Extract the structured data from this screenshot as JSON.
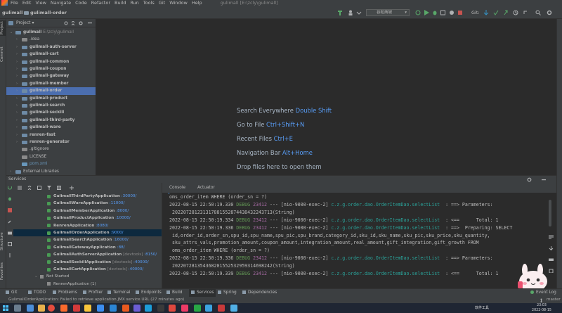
{
  "menubar": {
    "items": [
      "File",
      "Edit",
      "View",
      "Navigate",
      "Code",
      "Refactor",
      "Build",
      "Run",
      "Tools",
      "Git",
      "Window",
      "Help"
    ],
    "project_title": "gulimall [E:\\zcly\\gulimall]"
  },
  "navbar": {
    "breadcrumb": [
      "gulimall",
      "gulimall-order"
    ],
    "run_config": "谷粒商城",
    "git_label": "Git:"
  },
  "project": {
    "header": "Project",
    "tree": [
      {
        "label": "gulimall",
        "path": "E:\\zcly\\gulimall",
        "level": 0,
        "open": true,
        "bold": true
      },
      {
        "label": ".idea",
        "level": 1,
        "open": false,
        "bold": false
      },
      {
        "label": "gulimall-auth-server",
        "level": 1,
        "open": false,
        "bold": true
      },
      {
        "label": "gulimall-cart",
        "level": 1,
        "open": false,
        "bold": true
      },
      {
        "label": "gulimall-common",
        "level": 1,
        "open": false,
        "bold": true
      },
      {
        "label": "gulimall-coupon",
        "level": 1,
        "open": false,
        "bold": true
      },
      {
        "label": "gulimall-gateway",
        "level": 1,
        "open": false,
        "bold": true
      },
      {
        "label": "gulimall-member",
        "level": 1,
        "open": false,
        "bold": true
      },
      {
        "label": "gulimall-order",
        "level": 1,
        "open": false,
        "bold": true,
        "selected": true
      },
      {
        "label": "gulimall-product",
        "level": 1,
        "open": false,
        "bold": true
      },
      {
        "label": "gulimall-search",
        "level": 1,
        "open": false,
        "bold": true
      },
      {
        "label": "gulimall-seckill",
        "level": 1,
        "open": false,
        "bold": true
      },
      {
        "label": "gulimall-third-party",
        "level": 1,
        "open": false,
        "bold": true
      },
      {
        "label": "gulimall-ware",
        "level": 1,
        "open": false,
        "bold": true
      },
      {
        "label": "renren-fast",
        "level": 1,
        "open": false,
        "bold": true
      },
      {
        "label": "renren-generator",
        "level": 1,
        "open": false,
        "bold": true
      },
      {
        "label": ".gitignore",
        "level": 1,
        "leaf": true,
        "bold": false
      },
      {
        "label": "LICENSE",
        "level": 1,
        "leaf": true,
        "bold": false
      },
      {
        "label": "pom.xml",
        "level": 1,
        "leaf": true,
        "bold": false,
        "color": "#6897bb"
      },
      {
        "label": "External Libraries",
        "level": 0,
        "open": false,
        "bold": false
      }
    ]
  },
  "welcome": {
    "items": [
      {
        "label": "Search Everywhere",
        "key": "Double Shift"
      },
      {
        "label": "Go to File",
        "key": "Ctrl+Shift+N"
      },
      {
        "label": "Recent Files",
        "key": "Ctrl+E"
      },
      {
        "label": "Navigation Bar",
        "key": "Alt+Home"
      },
      {
        "label": "Drop files here to open them",
        "key": ""
      }
    ]
  },
  "services": {
    "header": "Services",
    "apps": [
      {
        "name": "GulimallThirdPartyApplication",
        "port": ":30000/",
        "dev": ""
      },
      {
        "name": "GulimallWareApplication",
        "port": ":11000/",
        "dev": ""
      },
      {
        "name": "GulimallMemberApplication",
        "port": ":8000/",
        "dev": ""
      },
      {
        "name": "GulimallProductApplication",
        "port": ":10000/",
        "dev": ""
      },
      {
        "name": "RenrenApplication",
        "port": ":8080/",
        "dev": ""
      },
      {
        "name": "GulimallOrderApplication",
        "port": ":9000/",
        "dev": "",
        "selected": true
      },
      {
        "name": "GulimallSearchApplication",
        "port": ":16000/",
        "dev": ""
      },
      {
        "name": "GulimallGatewayApplication",
        "port": ":88/",
        "dev": ""
      },
      {
        "name": "GulimallAuthServerApplication",
        "port": ":8150/",
        "dev": "[devtools] "
      },
      {
        "name": "GulimallSeckillApplication",
        "port": ":40000/",
        "dev": "[devtools] "
      },
      {
        "name": "GulimallCartApplication",
        "port": ":40000/",
        "dev": "[devtools] "
      }
    ],
    "not_started": "Not Started",
    "renren_group": "RenrenApplication (1)"
  },
  "console": {
    "tabs": [
      "Console",
      "Actuator"
    ],
    "lines": [
      {
        "text": "oms_order_item WHERE (order_sn = ?)"
      },
      {
        "ts": "2022-08-15 22:50:19.330",
        "lvl": "DEBUG",
        "pid": "23412",
        "mid": " --- [nio-9000-exec-2] ",
        "logger": "c.z.g.order.dao.OrderItemDao.selectList",
        "msg": "  : ==> Parameters:"
      },
      {
        "text": " 202207281231317881552874438432243713(String)"
      },
      {
        "ts": "2022-08-15 22:50:19.334",
        "lvl": "DEBUG",
        "pid": "23412",
        "mid": " --- [nio-9000-exec-2] ",
        "logger": "c.z.g.order.dao.OrderItemDao.selectList",
        "msg": "  : <==      Total: 1"
      },
      {
        "ts": "2022-08-15 22:50:19.336",
        "lvl": "DEBUG",
        "pid": "23412",
        "mid": " --- [nio-9000-exec-2] ",
        "logger": "c.z.g.order.dao.OrderItemDao.selectList",
        "msg": "  : ==>  Preparing: SELECT"
      },
      {
        "text": " id,order_id,order_sn,spu_id,spu_name,spu_pic,spu_brand,category_id,sku_id,sku_name,sku_pic,sku_price,sku_quantity,"
      },
      {
        "text": " sku_attrs_vals,promotion_amount,coupon_amount,integration_amount,real_amount,gift_integration,gift_growth FROM"
      },
      {
        "text": " oms_order_item WHERE (order_sn = ?)"
      },
      {
        "ts": "2022-08-15 22:50:19.336",
        "lvl": "DEBUG",
        "pid": "23412",
        "mid": " --- [nio-9000-exec-2] ",
        "logger": "c.z.g.order.dao.OrderItemDao.selectList",
        "msg": "  : ==> Parameters:"
      },
      {
        "text": " 202207281354368201552532959314698242(String)"
      },
      {
        "ts": "2022-08-15 22:50:19.339",
        "lvl": "DEBUG",
        "pid": "23412",
        "mid": " --- [nio-9000-exec-2] ",
        "logger": "c.z.g.order.dao.OrderItemDao.selectList",
        "msg": "  : <==      Total: 1"
      }
    ]
  },
  "bottom_tabs": [
    "Git",
    "TODO",
    "Problems",
    "Profiler",
    "Terminal",
    "Endpoints",
    "Build",
    "Services",
    "Spring",
    "Dependencies"
  ],
  "event_log": "Event Log",
  "status_text": "GulimallOrderApplication: Failed to retrieve application JMX service URL (27 minutes ago)",
  "status_branch": "master",
  "left_strip": [
    "Project",
    "Commit",
    "Structure",
    "Favorites"
  ],
  "taskbar": {
    "clock_time": "23:03",
    "clock_date": "2022-08-15",
    "tray": "软件工具"
  },
  "colors": {
    "accent": "#4b6eaf",
    "running": "#499c54",
    "link": "#589df6",
    "debug": "#629755",
    "logger": "#2aa198"
  }
}
